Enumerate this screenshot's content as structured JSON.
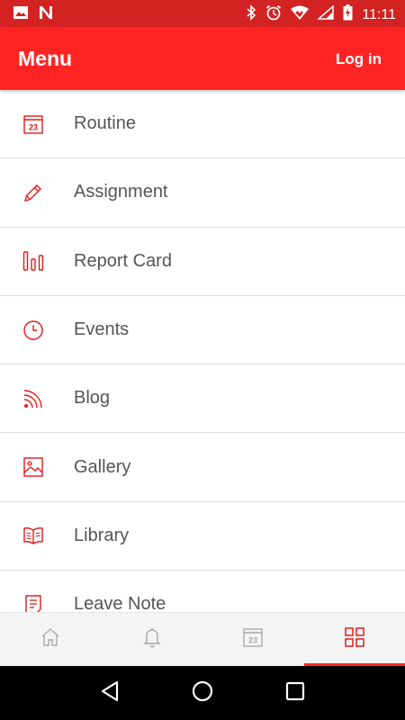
{
  "status_bar": {
    "time": "11:11",
    "left_icons": [
      "image-icon",
      "n-app-icon"
    ],
    "right_icons": [
      "bluetooth-icon",
      "alarm-icon",
      "wifi-icon",
      "signal-icon",
      "battery-icon"
    ]
  },
  "app_bar": {
    "title": "Menu",
    "login_label": "Log in"
  },
  "menu": {
    "items": [
      {
        "label": "Routine",
        "icon": "calendar-icon"
      },
      {
        "label": "Assignment",
        "icon": "pencil-icon"
      },
      {
        "label": "Report Card",
        "icon": "bar-chart-icon"
      },
      {
        "label": "Events",
        "icon": "clock-icon"
      },
      {
        "label": "Blog",
        "icon": "rss-icon"
      },
      {
        "label": "Gallery",
        "icon": "picture-icon"
      },
      {
        "label": "Library",
        "icon": "book-icon"
      },
      {
        "label": "Leave Note",
        "icon": "note-icon"
      }
    ]
  },
  "calendar_icon_text": "23",
  "bottom_nav": {
    "tabs": [
      {
        "name": "home",
        "icon": "home-icon",
        "active": false
      },
      {
        "name": "notifications",
        "icon": "bell-icon",
        "active": false
      },
      {
        "name": "calendar",
        "icon": "calendar-icon",
        "active": false
      },
      {
        "name": "menu",
        "icon": "grid-icon",
        "active": true
      }
    ]
  },
  "colors": {
    "accent": "#ff2424",
    "status_bar": "#d32222",
    "text": "#555555",
    "divider": "#dddddd"
  }
}
